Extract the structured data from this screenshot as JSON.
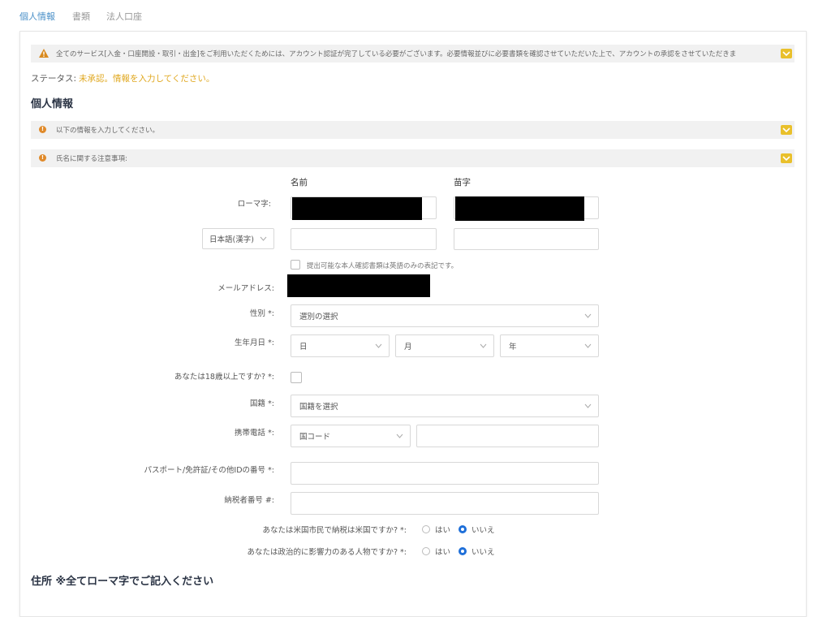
{
  "tabs": [
    "個人情報",
    "書類",
    "法人口座"
  ],
  "notice": {
    "text": "全てのサービス[入金・口座開設・取引・出金]をご利用いただくためには、アカウント認証が完了している必要がございます。必要情報並びに必要書類を確認させていただいた上で、アカウントの承認をさせていただきま"
  },
  "status": {
    "label": "ステータス:",
    "value": "未承認。情報を入力してください。",
    "color": "#e0a820"
  },
  "section_title": "個人情報",
  "info_bars": [
    "以下の情報を入力してください。",
    "氏名に関する注意事項:"
  ],
  "columns": {
    "first_name": "名前",
    "last_name": "苗字"
  },
  "form": {
    "romaji_label": "ローマ字:",
    "language_select": "日本語(漢字)",
    "english_only_note": "提出可能な本人確認書類は英語のみの表記です。",
    "email_label": "メールアドレス:",
    "gender_label": "性別 *:",
    "gender_placeholder": "選別の選択",
    "dob_label": "生年月日 *:",
    "dob_day": "日",
    "dob_month": "月",
    "dob_year": "年",
    "age_label": "あなたは18歳以上ですか? *:",
    "nationality_label": "国籍 *:",
    "nationality_placeholder": "国籍を選択",
    "phone_label": "携帯電話 *:",
    "phone_code_placeholder": "国コード",
    "id_label": "パスポート/免許証/その他IDの番号 *:",
    "tax_label": "納税者番号 #:",
    "us_label": "あなたは米国市民で納税は米国ですか? *:",
    "pep_label": "あなたは政治的に影響力のある人物ですか? *:",
    "yes": "はい",
    "no": "いいえ"
  },
  "address_title": "住所 ※全てローマ字でご記入ください",
  "colors": {
    "accent": "#e9c02b",
    "tab_active": "#4a90c8",
    "radio": "#1e6fd9"
  }
}
